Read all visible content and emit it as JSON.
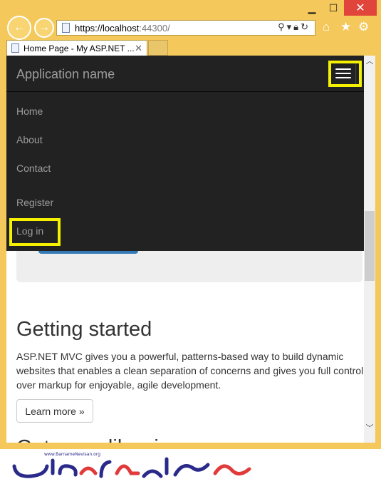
{
  "browser": {
    "url_host": "https://localhost",
    "url_port": ":44300/",
    "tab_title": "Home Page - My ASP.NET ...",
    "icons": [
      "back-icon",
      "forward-icon",
      "search-icon",
      "lock-icon",
      "refresh-icon",
      "home-icon",
      "star-icon",
      "gear-icon",
      "close-icon"
    ]
  },
  "window": {
    "min_glyph": "▁",
    "max_glyph": "☐",
    "close_glyph": "✕"
  },
  "navbar": {
    "brand": "Application name",
    "links": [
      "Home",
      "About",
      "Contact",
      "Register",
      "Log in"
    ]
  },
  "content": {
    "heading": "Getting started",
    "paragraph": "ASP.NET MVC gives you a powerful, patterns-based way to build dynamic websites that enables a clean separation of concerns and gives you full control over markup for enjoyable, agile development.",
    "button": "Learn more »",
    "next_heading": "Get more libraries"
  },
  "footer": {
    "site": "www.BarnameNevisan.org"
  },
  "colors": {
    "frame": "#f4c85a",
    "navbar": "#222222",
    "highlight": "#f5f000",
    "accent": "#337ab7"
  }
}
